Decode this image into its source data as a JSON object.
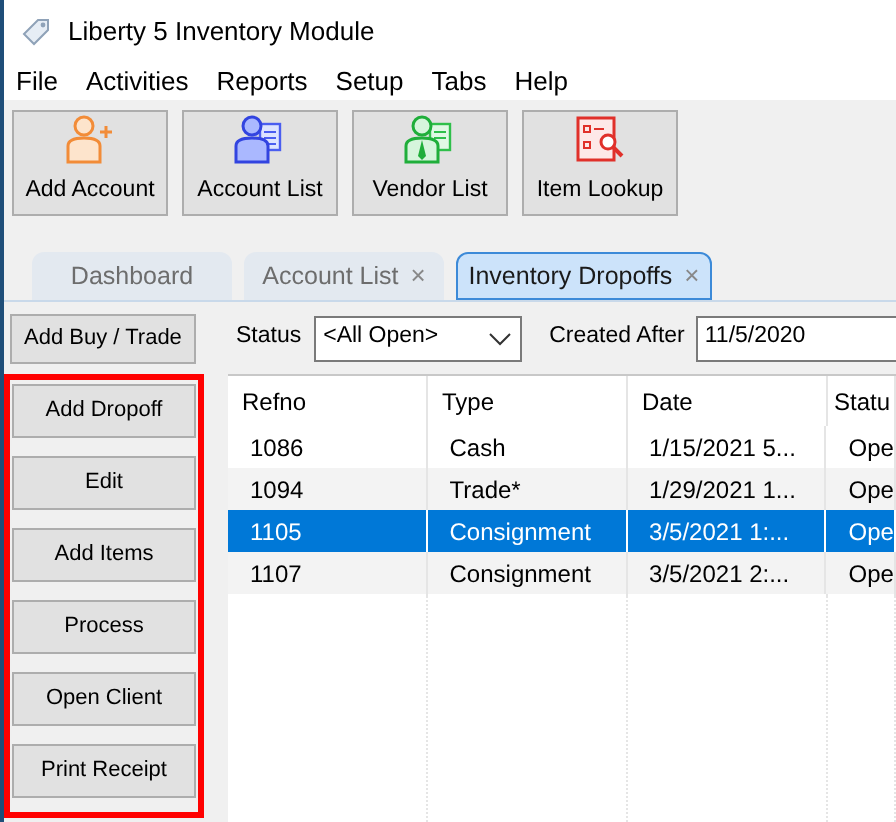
{
  "window": {
    "title": "Liberty 5 Inventory Module"
  },
  "menu": [
    "File",
    "Activities",
    "Reports",
    "Setup",
    "Tabs",
    "Help"
  ],
  "toolbar": [
    {
      "label": "Add Account"
    },
    {
      "label": "Account List"
    },
    {
      "label": "Vendor List"
    },
    {
      "label": "Item Lookup"
    }
  ],
  "tabs": [
    {
      "label": "Dashboard",
      "selected": false,
      "closable": false
    },
    {
      "label": "Account List",
      "selected": false,
      "closable": true
    },
    {
      "label": "Inventory Dropoffs",
      "selected": true,
      "closable": true
    }
  ],
  "close_glyph": "×",
  "add_buy_trade": "Add Buy / Trade",
  "filters": {
    "status_label": "Status",
    "status_value": "<All Open>",
    "created_label": "Created After",
    "created_value": "11/5/2020"
  },
  "action_panel": {
    "highlighted": true,
    "buttons": [
      "Add Dropoff",
      "Edit",
      "Add Items",
      "Process",
      "Open Client",
      "Print Receipt"
    ]
  },
  "table": {
    "columns": [
      "Refno",
      "Type",
      "Date",
      "Statu"
    ],
    "rows": [
      {
        "cells": [
          "1086",
          "Cash",
          "1/15/2021 5...",
          "Ope"
        ],
        "selected": false
      },
      {
        "cells": [
          "1094",
          "Trade*",
          "1/29/2021 1...",
          "Ope"
        ],
        "selected": false
      },
      {
        "cells": [
          "1105",
          "Consignment",
          "3/5/2021 1:...",
          "Ope"
        ],
        "selected": true
      },
      {
        "cells": [
          "1107",
          "Consignment",
          "3/5/2021 2:...",
          "Ope"
        ],
        "selected": false
      }
    ]
  }
}
